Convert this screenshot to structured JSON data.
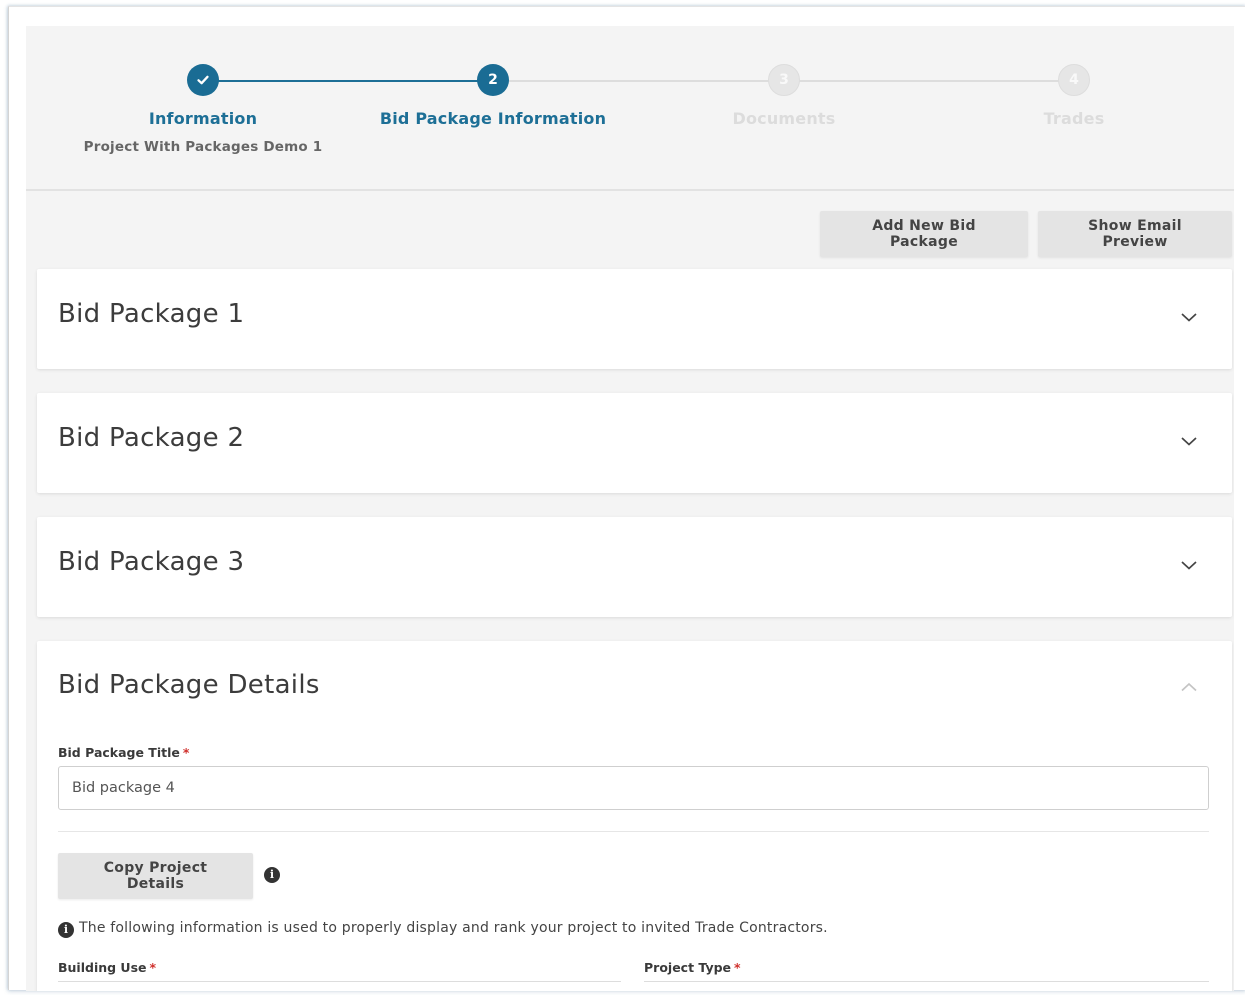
{
  "stepper": {
    "steps": [
      {
        "number": "✓",
        "label": "Information",
        "subtitle": "Project With Packages Demo 1",
        "state": "complete"
      },
      {
        "number": "2",
        "label": "Bid Package Information",
        "state": "active"
      },
      {
        "number": "3",
        "label": "Documents",
        "state": "inactive"
      },
      {
        "number": "4",
        "label": "Trades",
        "state": "inactive"
      }
    ]
  },
  "toolbar": {
    "add_label": "Add New Bid Package",
    "preview_label": "Show Email Preview"
  },
  "packages": [
    {
      "title": "Bid Package 1",
      "expanded": false
    },
    {
      "title": "Bid Package 2",
      "expanded": false
    },
    {
      "title": "Bid Package 3",
      "expanded": false
    }
  ],
  "details": {
    "title": "Bid Package Details",
    "expanded": true,
    "title_field": {
      "label": "Bid Package Title",
      "required_mark": "*",
      "value": "Bid package 4"
    },
    "copy_button": "Copy Project Details",
    "info_glyph": "i",
    "info_text": "The following information is used to properly display and rank your project to invited Trade Contractors.",
    "building_use": {
      "label": "Building Use",
      "required_mark": "*"
    },
    "project_type": {
      "label": "Project Type",
      "required_mark": "*"
    }
  },
  "colors": {
    "accent": "#1a6c94",
    "required": "#d0312d",
    "background": "#f4f4f4",
    "button": "#e4e4e4"
  }
}
